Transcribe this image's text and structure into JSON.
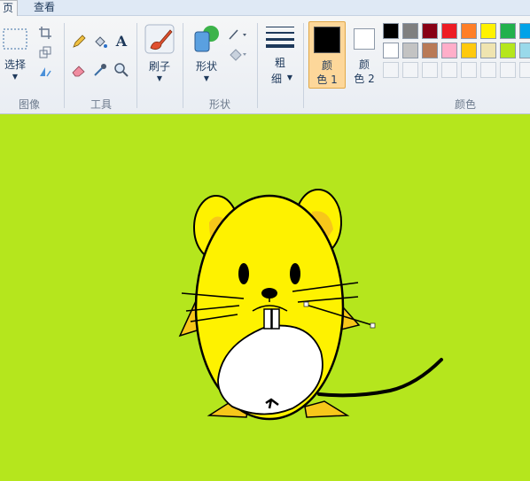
{
  "tabs": [
    {
      "label": "页"
    },
    {
      "label": "查看"
    }
  ],
  "groups": {
    "image": {
      "label": "图像",
      "select_label": "选择"
    },
    "tools": {
      "label": "工具"
    },
    "brush": {
      "label": "刷子"
    },
    "shapes": {
      "label": "形状",
      "shapes_button": "形状"
    },
    "size": {
      "line1": "粗",
      "line2": "细"
    },
    "colors": {
      "label": "颜色",
      "color1": {
        "line1": "颜",
        "line2": "色 1",
        "value": "#000000"
      },
      "color2": {
        "line1": "颜",
        "line2": "色 2",
        "value": "#ffffff"
      },
      "palette_row1": [
        "#000000",
        "#7f7f7f",
        "#880015",
        "#ed1c24",
        "#ff7f27",
        "#fff200",
        "#22b14c",
        "#00a2e8"
      ],
      "palette_row2": [
        "#ffffff",
        "#c3c3c3",
        "#b97a57",
        "#ffaec9",
        "#ffc90e",
        "#efe4b0",
        "#b5e61d",
        "#99d9ea"
      ]
    }
  },
  "canvas": {
    "background": "#b5e61d"
  },
  "icons": [
    "crop-icon",
    "resize-icon",
    "rotate-icon",
    "pencil-icon",
    "fill-icon",
    "text-icon",
    "eraser-icon",
    "color-picker-icon",
    "magnifier-icon",
    "brush-icon",
    "shapes-icon",
    "outline-icon",
    "fill-shape-icon",
    "size-icon"
  ]
}
